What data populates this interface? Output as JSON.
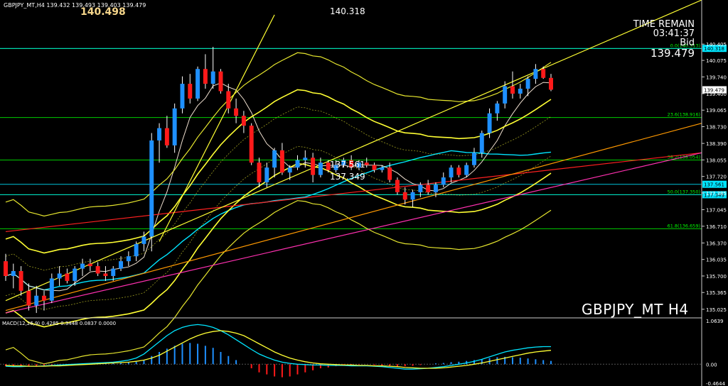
{
  "header": {
    "info": "GBPJPY_MT,H4  139.432 139.493 139.403 139.479",
    "big_price": "140.498"
  },
  "timer": {
    "title": "TIME REMAIN",
    "time": "03:41:37",
    "bid_label": "Bid",
    "bid_value": "139.479"
  },
  "symbol_label": "GBPJPY_MT  H4",
  "macd_header": "MACD(12,26,9) 0.4285 0.3448 0.0837 0.0000",
  "colors": {
    "background": "#000000",
    "bull": "#1e90ff",
    "bear": "#ff1a1a",
    "bands": "#ffff33",
    "fib": "#00ff00",
    "ma_slow": "#00e5ff",
    "ma_fast": "#f0e0d0",
    "trend_red": "#ff2020",
    "trend_orange": "#ff9900",
    "trend_pink": "#ff30b0",
    "macd_signal": "#ffff33",
    "macd_line": "#00e5ff"
  },
  "chart_data": {
    "type": "candlestick",
    "symbol": "GBPJPY_MT",
    "timeframe": "H4",
    "ylim": [
      134.85,
      141.3
    ],
    "price_ticks": [
      "140.405",
      "140.075",
      "139.740",
      "139.400",
      "139.065",
      "138.730",
      "138.390",
      "138.055",
      "137.720",
      "137.385",
      "137.045",
      "136.710",
      "136.370",
      "136.035",
      "135.700",
      "135.365",
      "135.025"
    ],
    "highlighted_levels": [
      {
        "label": "140.318",
        "value": 140.318
      },
      {
        "label": "139.479",
        "value": 139.479
      },
      {
        "label": "137.561",
        "value": 137.561
      },
      {
        "label": "137.349",
        "value": 137.349
      }
    ],
    "fibonacci": [
      {
        "label": "0.0(140.313)",
        "value": 140.313
      },
      {
        "label": "23.6(138.916)",
        "value": 138.916
      },
      {
        "label": "38.2(138.054)",
        "value": 138.054
      },
      {
        "label": "50.0(137.350)",
        "value": 137.35
      },
      {
        "label": "61.8(136.659)",
        "value": 136.659
      }
    ],
    "annotations": [
      {
        "text": "140.318",
        "value": 140.318
      },
      {
        "text": "137.561",
        "value": 137.561
      },
      {
        "text": "137.349",
        "value": 137.349
      }
    ],
    "candles": [
      [
        136.0,
        136.15,
        135.6,
        135.7
      ],
      [
        135.7,
        135.95,
        135.45,
        135.8
      ],
      [
        135.8,
        135.9,
        135.3,
        135.4
      ],
      [
        135.4,
        135.55,
        135.0,
        135.1
      ],
      [
        135.1,
        135.5,
        134.95,
        135.3
      ],
      [
        135.3,
        135.4,
        135.0,
        135.2
      ],
      [
        135.2,
        135.75,
        135.15,
        135.65
      ],
      [
        135.65,
        135.9,
        135.5,
        135.75
      ],
      [
        135.75,
        135.85,
        135.55,
        135.6
      ],
      [
        135.6,
        135.9,
        135.5,
        135.85
      ],
      [
        135.85,
        136.05,
        135.7,
        135.95
      ],
      [
        135.95,
        136.05,
        135.8,
        135.9
      ],
      [
        135.9,
        135.98,
        135.7,
        135.75
      ],
      [
        135.75,
        135.9,
        135.6,
        135.7
      ],
      [
        135.7,
        135.9,
        135.6,
        135.85
      ],
      [
        135.85,
        136.1,
        135.8,
        136.0
      ],
      [
        136.0,
        136.2,
        135.9,
        136.1
      ],
      [
        136.1,
        136.4,
        136.0,
        136.35
      ],
      [
        136.35,
        136.6,
        136.2,
        136.5
      ],
      [
        136.5,
        138.6,
        136.2,
        138.45
      ],
      [
        138.45,
        138.8,
        138.0,
        138.7
      ],
      [
        138.7,
        138.95,
        138.3,
        138.35
      ],
      [
        138.35,
        139.2,
        138.2,
        139.1
      ],
      [
        139.1,
        139.75,
        139.0,
        139.6
      ],
      [
        139.6,
        139.8,
        139.2,
        139.3
      ],
      [
        139.3,
        139.95,
        139.25,
        139.9
      ],
      [
        139.9,
        140.2,
        139.5,
        139.6
      ],
      [
        139.6,
        140.35,
        139.5,
        139.85
      ],
      [
        139.85,
        139.9,
        139.4,
        139.45
      ],
      [
        139.45,
        139.6,
        139.0,
        139.1
      ],
      [
        139.1,
        139.3,
        138.8,
        138.95
      ],
      [
        138.95,
        139.05,
        138.6,
        138.75
      ],
      [
        138.75,
        138.8,
        137.95,
        138.0
      ],
      [
        138.0,
        138.1,
        137.5,
        137.6
      ],
      [
        137.6,
        138.0,
        137.5,
        137.9
      ],
      [
        137.9,
        138.3,
        137.7,
        138.25
      ],
      [
        138.25,
        138.4,
        137.75,
        137.8
      ],
      [
        137.8,
        137.95,
        137.65,
        137.9
      ],
      [
        137.9,
        138.15,
        137.85,
        138.05
      ],
      [
        138.05,
        138.25,
        137.9,
        138.1
      ],
      [
        138.1,
        138.2,
        137.6,
        137.75
      ],
      [
        137.75,
        138.1,
        137.7,
        138.0
      ],
      [
        138.0,
        138.05,
        137.8,
        137.85
      ],
      [
        137.85,
        138.05,
        137.8,
        137.95
      ],
      [
        137.95,
        138.1,
        137.9,
        138.05
      ],
      [
        138.05,
        138.15,
        137.85,
        137.9
      ],
      [
        137.9,
        138.05,
        137.85,
        138.0
      ],
      [
        138.0,
        138.1,
        137.9,
        137.95
      ],
      [
        137.95,
        138.0,
        137.8,
        137.85
      ],
      [
        137.85,
        137.95,
        137.8,
        137.9
      ],
      [
        137.9,
        138.0,
        137.6,
        137.65
      ],
      [
        137.65,
        137.7,
        137.35,
        137.4
      ],
      [
        137.4,
        137.5,
        137.15,
        137.25
      ],
      [
        137.25,
        137.45,
        137.1,
        137.4
      ],
      [
        137.4,
        137.6,
        137.3,
        137.55
      ],
      [
        137.55,
        137.65,
        137.35,
        137.4
      ],
      [
        137.4,
        137.6,
        137.3,
        137.55
      ],
      [
        137.55,
        137.8,
        137.5,
        137.7
      ],
      [
        137.7,
        137.95,
        137.6,
        137.9
      ],
      [
        137.9,
        137.95,
        137.7,
        137.75
      ],
      [
        137.75,
        138.0,
        137.7,
        137.95
      ],
      [
        137.95,
        138.3,
        137.9,
        138.2
      ],
      [
        138.2,
        138.65,
        138.1,
        138.6
      ],
      [
        138.6,
        139.1,
        138.5,
        139.0
      ],
      [
        139.0,
        139.25,
        138.85,
        139.2
      ],
      [
        139.2,
        139.65,
        139.1,
        139.55
      ],
      [
        139.55,
        139.85,
        139.3,
        139.4
      ],
      [
        139.4,
        139.6,
        139.3,
        139.5
      ],
      [
        139.5,
        139.75,
        139.35,
        139.7
      ],
      [
        139.7,
        140.0,
        139.6,
        139.9
      ],
      [
        139.9,
        139.95,
        139.7,
        139.72
      ],
      [
        139.72,
        139.8,
        139.45,
        139.48
      ]
    ],
    "trend_lines": [
      {
        "color": "red",
        "from": [
          0,
          136.6
        ],
        "to": [
          71,
          138.2
        ]
      },
      {
        "color": "orange",
        "from": [
          0,
          135.0
        ],
        "to": [
          71,
          138.8
        ]
      },
      {
        "color": "pink",
        "from": [
          0,
          134.95
        ],
        "to": [
          71,
          138.2
        ]
      },
      {
        "color": "yellow",
        "from": [
          0,
          135.2
        ],
        "to": [
          71,
          141.3
        ]
      },
      {
        "color": "yellow",
        "from": [
          20,
          136.4
        ],
        "to": [
          35,
          141.0
        ]
      }
    ],
    "macd": {
      "title": "MACD(12,26,9)",
      "values": {
        "macd": 0.4285,
        "signal": 0.3448,
        "histogram": 0.0837,
        "zero": 0.0
      },
      "ylim": [
        -0.4644,
        1.0639
      ],
      "ticks": [
        "1.0639",
        "0.00",
        "-0.4644"
      ],
      "histogram": [
        -0.05,
        -0.06,
        -0.04,
        -0.05,
        -0.06,
        -0.05,
        -0.04,
        -0.03,
        -0.02,
        -0.03,
        -0.02,
        0.01,
        0.02,
        0.03,
        0.04,
        0.03,
        0.05,
        0.06,
        0.1,
        0.2,
        0.3,
        0.38,
        0.45,
        0.5,
        0.52,
        0.5,
        0.45,
        0.4,
        0.3,
        0.2,
        0.1,
        0.0,
        -0.1,
        -0.2,
        -0.25,
        -0.3,
        -0.32,
        -0.3,
        -0.25,
        -0.2,
        -0.15,
        -0.1,
        -0.08,
        -0.05,
        -0.03,
        -0.02,
        -0.01,
        0.0,
        -0.02,
        -0.03,
        -0.05,
        -0.06,
        -0.05,
        -0.04,
        -0.02,
        0.0,
        0.02,
        0.03,
        0.05,
        0.06,
        0.08,
        0.1,
        0.12,
        0.15,
        0.17,
        0.18,
        0.17,
        0.16,
        0.14,
        0.12,
        0.1,
        0.08
      ],
      "macd_line": [
        -0.05,
        -0.06,
        -0.06,
        -0.05,
        -0.05,
        -0.04,
        -0.03,
        -0.02,
        -0.01,
        0.0,
        0.01,
        0.02,
        0.03,
        0.04,
        0.05,
        0.07,
        0.1,
        0.15,
        0.25,
        0.4,
        0.55,
        0.7,
        0.82,
        0.9,
        0.95,
        0.97,
        0.95,
        0.9,
        0.82,
        0.72,
        0.6,
        0.48,
        0.36,
        0.25,
        0.17,
        0.1,
        0.05,
        0.02,
        0.0,
        -0.01,
        -0.02,
        -0.02,
        -0.03,
        -0.03,
        -0.03,
        -0.04,
        -0.04,
        -0.04,
        -0.05,
        -0.06,
        -0.08,
        -0.1,
        -0.12,
        -0.12,
        -0.11,
        -0.1,
        -0.08,
        -0.06,
        -0.03,
        0.0,
        0.03,
        0.07,
        0.12,
        0.18,
        0.24,
        0.3,
        0.34,
        0.37,
        0.4,
        0.42,
        0.43,
        0.43
      ],
      "signal_line": [
        -0.03,
        -0.04,
        -0.04,
        -0.05,
        -0.05,
        -0.05,
        -0.04,
        -0.04,
        -0.03,
        -0.02,
        -0.01,
        0.0,
        0.01,
        0.02,
        0.03,
        0.04,
        0.05,
        0.07,
        0.1,
        0.15,
        0.22,
        0.32,
        0.42,
        0.52,
        0.62,
        0.7,
        0.76,
        0.8,
        0.82,
        0.8,
        0.76,
        0.7,
        0.6,
        0.5,
        0.4,
        0.3,
        0.22,
        0.15,
        0.1,
        0.06,
        0.03,
        0.01,
        0.0,
        -0.01,
        -0.02,
        -0.02,
        -0.03,
        -0.03,
        -0.04,
        -0.04,
        -0.05,
        -0.06,
        -0.08,
        -0.09,
        -0.1,
        -0.1,
        -0.1,
        -0.09,
        -0.07,
        -0.05,
        -0.03,
        0.0,
        0.03,
        0.07,
        0.11,
        0.15,
        0.19,
        0.23,
        0.27,
        0.3,
        0.32,
        0.34
      ]
    }
  }
}
